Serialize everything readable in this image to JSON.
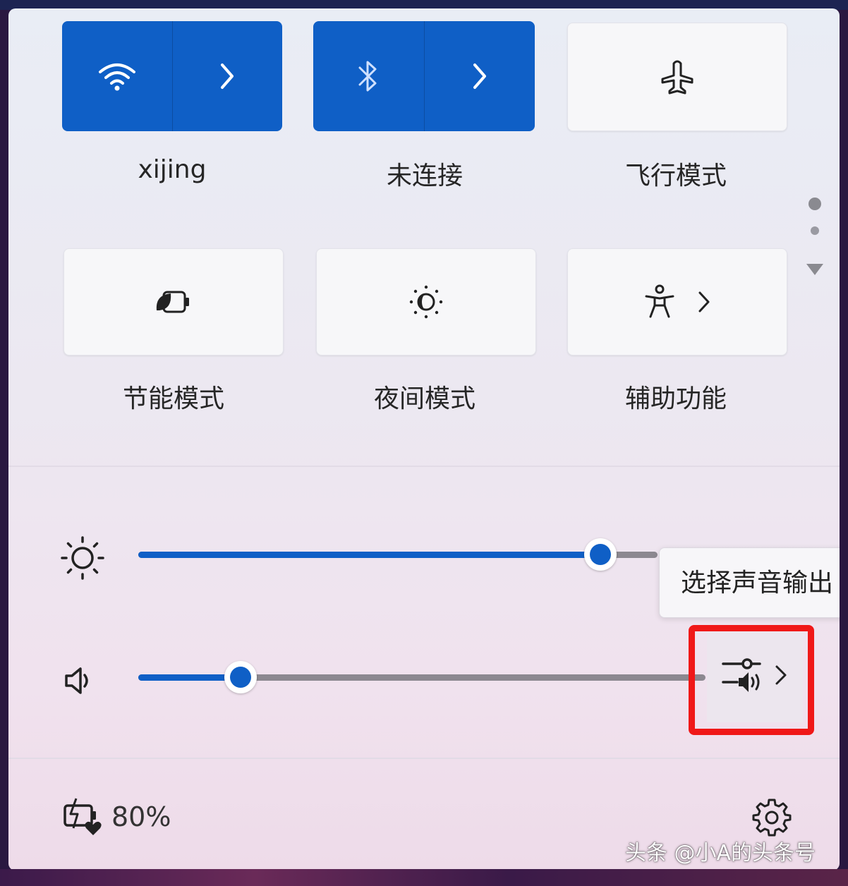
{
  "quick_settings": {
    "wifi": {
      "label": "xijing",
      "active": true
    },
    "bluetooth": {
      "label": "未连接",
      "active": true
    },
    "airplane": {
      "label": "飞行模式",
      "active": false
    },
    "battery_saver": {
      "label": "节能模式",
      "active": false
    },
    "night_light": {
      "label": "夜间模式",
      "active": false
    },
    "accessibility": {
      "label": "辅助功能",
      "active": false
    }
  },
  "sliders": {
    "brightness": {
      "value_percent": 89
    },
    "volume": {
      "value_percent": 18
    }
  },
  "tooltip": {
    "text": "选择声音输出"
  },
  "footer": {
    "battery_text": "80%"
  },
  "watermark": {
    "text": "头条 @小A的头条号"
  },
  "colors": {
    "accent": "#0f5fc6",
    "highlight_box": "#f01818"
  },
  "icons": [
    "wifi-icon",
    "bluetooth-icon",
    "chevron-right-icon",
    "airplane-icon",
    "battery-saver-icon",
    "night-light-icon",
    "accessibility-icon",
    "brightness-icon",
    "volume-icon",
    "audio-output-icon",
    "battery-charging-icon",
    "settings-gear-icon"
  ]
}
